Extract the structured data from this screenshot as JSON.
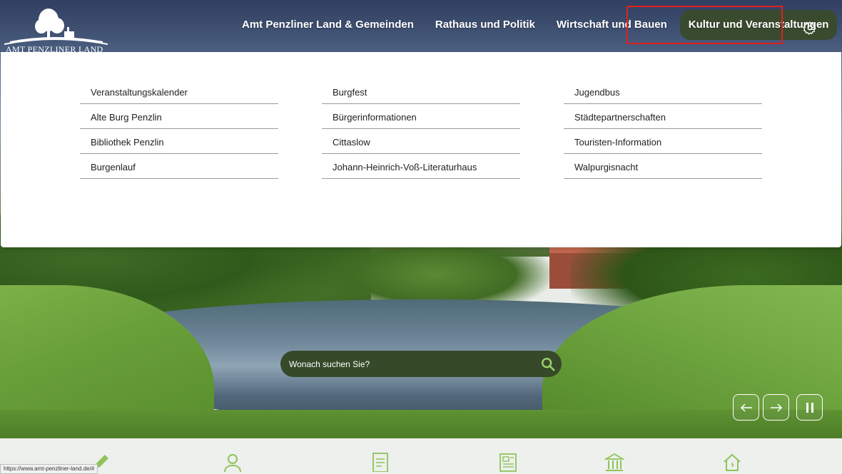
{
  "logo": {
    "text": "AMT PENZLINER LAND"
  },
  "nav": {
    "items": [
      {
        "label": "Amt Penzliner Land & Gemeinden"
      },
      {
        "label": "Rathaus und Politik"
      },
      {
        "label": "Wirtschaft und Bauen"
      },
      {
        "label": "Kultur und Veranstaltungen"
      }
    ],
    "active_index": 3
  },
  "menu": {
    "columns": [
      [
        "Veranstaltungskalender",
        "Alte Burg Penzlin",
        "Bibliothek Penzlin",
        "Burgenlauf"
      ],
      [
        "Burgfest",
        "Bürgerinformationen",
        "Cittaslow",
        "Johann-Heinrich-Voß-Literaturhaus"
      ],
      [
        "Jugendbus",
        "Städtepartnerschaften",
        "Touristen-Information",
        "Walpurgisnacht"
      ]
    ]
  },
  "search": {
    "placeholder": "Wonach suchen Sie?"
  },
  "status_url": "https://www.amt-penzliner-land.de/#",
  "colors": {
    "accent": "#364a2a",
    "highlight": "#e02020",
    "menu_divider": "#9a9a9a"
  },
  "icons": {
    "settings": "gear-icon",
    "search": "search-icon",
    "prev": "arrow-left-icon",
    "next": "arrow-right-icon",
    "pause": "pause-icon",
    "bottom": [
      "pencil-icon",
      "person-icon",
      "document-icon",
      "newspaper-icon",
      "town-hall-icon",
      "house-icon"
    ]
  }
}
